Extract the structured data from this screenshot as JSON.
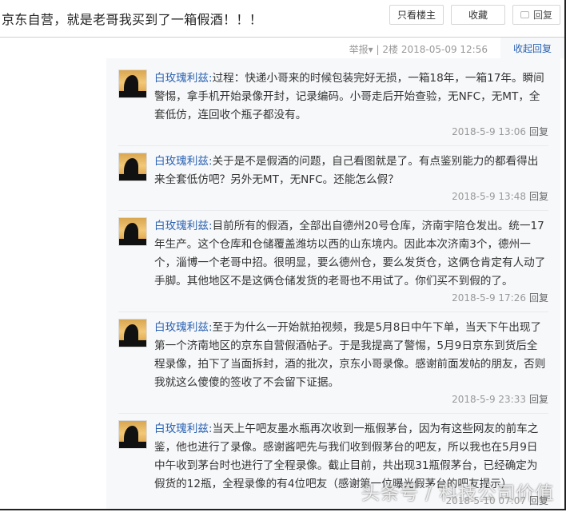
{
  "header": {
    "title": "京东自营，就是老哥我买到了一箱假酒！！！",
    "buttons": {
      "only_op": "只看楼主",
      "favorite": "收藏",
      "reply": "回复"
    }
  },
  "meta": {
    "report": "举报▾",
    "separator": "|",
    "floor": "2楼",
    "datetime": "2018-05-09 12:56",
    "collapse": "收起回复"
  },
  "comments": [
    {
      "user": "白玫瑰利兹:",
      "text": "过程：快递小哥来的时候包装完好无损，一箱18年，一箱17年。瞬间警惕，拿手机开始录像开封，记录编码。小哥走后开始查验，无NFC，无MT，全套低仿，连回收个瓶子都没有。",
      "time": "2018-5-9 13:06",
      "reply": "回复"
    },
    {
      "user": "白玫瑰利兹:",
      "text": "关于是不是假酒的问题，自己看图就是了。有点鉴别能力的都看得出来全套低仿吧？另外无MT，无NFC。还能怎么假？",
      "time": "2018-5-9 13:48",
      "reply": "回复"
    },
    {
      "user": "白玫瑰利兹:",
      "text": "目前所有的假酒，全部出自德州20号仓库，济南宇陪仓发出。统一17年生产。这个仓库和仓储覆盖潍坊以西的山东境内。因此本次济南3个，德州一个，淄博一个老哥中招。很明显，要么德州仓，要么发货仓，这俩仓肯定有人动了手脚。其他地区不是这俩仓储发货的老哥也不用试了。你们买不到假的了。",
      "time": "2018-5-9 17:26",
      "reply": "回复"
    },
    {
      "user": "白玫瑰利兹:",
      "text": "至于为什么一开始就拍视频，我是5月8日中午下单，当天下午出现了第一个济南地区的京东自营假酒帖子。于是我提高了警惕，5月9日京东到货后全程录像，拍下了当面拆封，酒的批次，京东小哥录像。感谢前面发帖的朋友，否则我就这么傻傻的签收了不会留下证据。",
      "time": "2018-5-9 23:33",
      "reply": "回复"
    },
    {
      "user": "白玫瑰利兹:",
      "text": "当天上午吧友墨水瓶再次收到一瓶假茅台，因为有这些网友的前车之鉴，他也进行了录像。感谢酱吧先与我们收到假茅台的吧友，所以我也在5月9日中午收到茅台时也进行了全程录像。截止目前，共出现31瓶假茅台，已经确定为假货的12瓶，全程录像的有4位吧友（感谢第一位曝光假茅台的吧友提示）",
      "time": "2018-5-10 07:07",
      "reply": "回复"
    }
  ],
  "watermark": "头条号 / 科技公司价值"
}
